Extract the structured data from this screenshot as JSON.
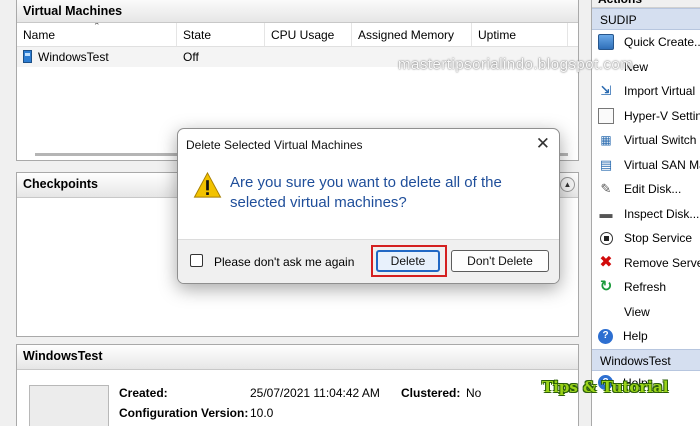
{
  "vm_pane": {
    "title": "Virtual Machines",
    "columns": [
      "Name",
      "State",
      "CPU Usage",
      "Assigned Memory",
      "Uptime"
    ],
    "rows": [
      {
        "name": "WindowsTest",
        "state": "Off",
        "cpu_usage": "",
        "assigned_memory": "",
        "uptime": ""
      }
    ]
  },
  "checkpoints_pane": {
    "title": "Checkpoints"
  },
  "details_pane": {
    "title": "WindowsTest",
    "created_label": "Created:",
    "created_value": "25/07/2021 11:04:42 AM",
    "clustered_label": "Clustered:",
    "clustered_value": "No",
    "config_label": "Configuration Version:",
    "config_value": "10.0"
  },
  "actions_pane": {
    "title": "Actions",
    "host_group": "SUDIP",
    "host_items": [
      {
        "label": "Quick Create...",
        "icon": "quick-create-icon"
      },
      {
        "label": "New",
        "icon": ""
      },
      {
        "label": "Import Virtual",
        "icon": "import-icon"
      },
      {
        "label": "Hyper-V Settin",
        "icon": "settings-icon"
      },
      {
        "label": "Virtual Switch",
        "icon": "virtual-switch-icon"
      },
      {
        "label": "Virtual SAN Ma",
        "icon": "virtual-san-icon"
      },
      {
        "label": "Edit Disk...",
        "icon": "edit-disk-icon"
      },
      {
        "label": "Inspect Disk...",
        "icon": "inspect-disk-icon"
      },
      {
        "label": "Stop Service",
        "icon": "stop-icon"
      },
      {
        "label": "Remove Server",
        "icon": "remove-icon"
      },
      {
        "label": "Refresh",
        "icon": "refresh-icon"
      },
      {
        "label": "View",
        "icon": ""
      },
      {
        "label": "Help",
        "icon": "help-icon"
      }
    ],
    "vm_group": "WindowsTest",
    "vm_items": [
      {
        "label": "Help",
        "icon": "help-icon"
      }
    ]
  },
  "dialog": {
    "title": "Delete Selected Virtual Machines",
    "message": "Are you sure you want to delete all of the selected virtual machines?",
    "checkbox_label": "Please don't ask me again",
    "checkbox_checked": false,
    "delete_label": "Delete",
    "dont_delete_label": "Don't Delete"
  },
  "overlays": {
    "watermark": "mastertipsorialindo.blogspot.com",
    "logo_text": "Tips & Tutorial"
  },
  "colors": {
    "group_header_bg": "#d5dff0",
    "dialog_message": "#1f4e9a",
    "primary_button_border": "#2168c5",
    "highlight_box": "#d42020",
    "warning_icon": "#f2c200"
  }
}
